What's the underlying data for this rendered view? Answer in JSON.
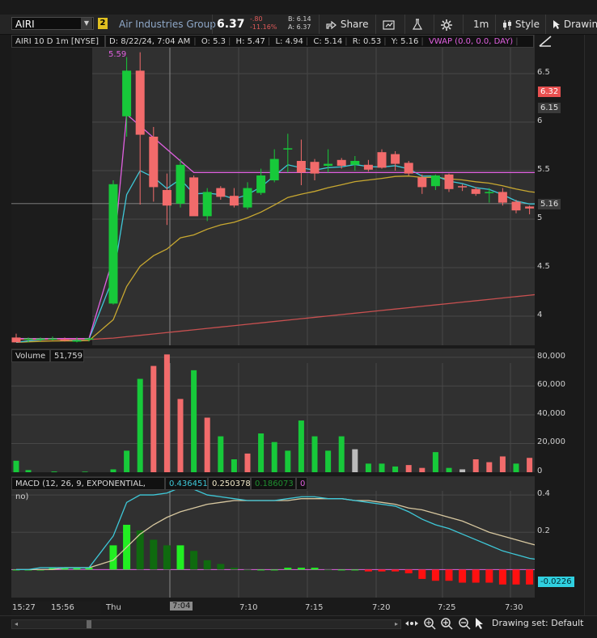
{
  "toolbar": {
    "symbol": "AIRI",
    "link_badge": "2",
    "company": "Air Industries Group",
    "last_price": "6.37",
    "change": "-.80",
    "change_pct": "-11.16%",
    "bid": "B: 6.14",
    "ask": "A: 6.37",
    "share_label": "Share",
    "timeframe_label": "1m",
    "style_label": "Style",
    "drawing_label": "Drawin"
  },
  "price_panel": {
    "symbol_label": "AIRI 10 D 1m [NYSE]",
    "ohlc": {
      "date": "D: 8/22/24, 7:04 AM",
      "open": "O: 5.3",
      "high": "H: 5.47",
      "low": "L: 4.94",
      "close": "C: 5.14",
      "range": "R: 0.53",
      "y": "Y: 5.16"
    },
    "vwap_label": "VWAP (0.0, 0.0, DAY)",
    "vwap_value": "5.59",
    "y_ticks": [
      "6.5",
      "6",
      "5.5",
      "5",
      "4.5",
      "4"
    ],
    "price_tags": [
      {
        "label": "6.32",
        "color": "#e85050"
      },
      {
        "label": "6.15",
        "color": "#3a3a3a"
      },
      {
        "label": "5.16",
        "color": "#3a3a3a"
      }
    ]
  },
  "volume_panel": {
    "label": "Volume",
    "value": "51,759",
    "y_ticks": [
      "80,000",
      "60,000",
      "40,000",
      "20,000",
      "0"
    ]
  },
  "macd_panel": {
    "label": "MACD (12, 26, 9, EXPONENTIAL, no)",
    "value": "0.436451",
    "avg": "0.250378",
    "diff": "0.186073",
    "zero": "0",
    "y_ticks": [
      "0.4",
      "0.2"
    ],
    "current_tag": "-0.0226"
  },
  "x_axis": {
    "labels": [
      "15:27",
      "15:56",
      "Thu",
      "7:04",
      "7:10",
      "7:15",
      "7:20",
      "7:25",
      "7:30"
    ],
    "highlight": "7:04"
  },
  "footer": {
    "drawing_set": "Drawing set: Default"
  },
  "colors": {
    "up": "#17c93a",
    "down": "#f26b6b",
    "vwap": "#e060e0",
    "ema_fast": "#3ec8d8",
    "ema_mid": "#c8a830",
    "ema_slow": "#c85050",
    "macd_line": "#3ec8d8",
    "signal_line": "#d8c8a0"
  },
  "chart_data": {
    "type": "candlestick",
    "candles": [
      {
        "o": 3.78,
        "h": 3.82,
        "l": 3.74,
        "c": 3.73
      },
      {
        "o": 3.76,
        "h": 3.78,
        "l": 3.73,
        "c": 3.77
      },
      {
        "o": 3.76,
        "h": 3.78,
        "l": 3.74,
        "c": 3.77
      },
      {
        "o": 3.77,
        "h": 3.79,
        "l": 3.75,
        "c": 3.77
      },
      {
        "o": 3.76,
        "h": 3.78,
        "l": 3.74,
        "c": 3.75
      },
      {
        "o": 3.75,
        "h": 3.78,
        "l": 3.73,
        "c": 3.75
      },
      {
        "o": 3.76,
        "h": 3.78,
        "l": 3.74,
        "c": 3.77
      },
      {
        "o": 4.13,
        "h": 5.4,
        "l": 4.12,
        "c": 5.36
      },
      {
        "o": 6.06,
        "h": 6.67,
        "l": 5.85,
        "c": 6.53
      },
      {
        "o": 6.53,
        "h": 6.72,
        "l": 5.15,
        "c": 5.87
      },
      {
        "o": 5.85,
        "h": 5.95,
        "l": 5.18,
        "c": 5.33
      },
      {
        "o": 5.3,
        "h": 5.47,
        "l": 4.94,
        "c": 5.14
      },
      {
        "o": 5.16,
        "h": 5.62,
        "l": 5.12,
        "c": 5.56
      },
      {
        "o": 5.43,
        "h": 5.45,
        "l": 5.04,
        "c": 5.03
      },
      {
        "o": 5.03,
        "h": 5.32,
        "l": 4.98,
        "c": 5.28
      },
      {
        "o": 5.32,
        "h": 5.34,
        "l": 5.2,
        "c": 5.23
      },
      {
        "o": 5.24,
        "h": 5.32,
        "l": 5.12,
        "c": 5.14
      },
      {
        "o": 5.12,
        "h": 5.38,
        "l": 5.1,
        "c": 5.32
      },
      {
        "o": 5.27,
        "h": 5.52,
        "l": 5.25,
        "c": 5.45
      },
      {
        "o": 5.4,
        "h": 5.72,
        "l": 5.38,
        "c": 5.62
      },
      {
        "o": 5.72,
        "h": 5.88,
        "l": 5.48,
        "c": 5.73
      },
      {
        "o": 5.6,
        "h": 5.82,
        "l": 5.35,
        "c": 5.48
      },
      {
        "o": 5.59,
        "h": 5.62,
        "l": 5.4,
        "c": 5.47
      },
      {
        "o": 5.55,
        "h": 5.72,
        "l": 5.48,
        "c": 5.57
      },
      {
        "o": 5.61,
        "h": 5.63,
        "l": 5.52,
        "c": 5.55
      },
      {
        "o": 5.56,
        "h": 5.65,
        "l": 5.5,
        "c": 5.6
      },
      {
        "o": 5.56,
        "h": 5.61,
        "l": 5.49,
        "c": 5.51
      },
      {
        "o": 5.69,
        "h": 5.72,
        "l": 5.52,
        "c": 5.53
      },
      {
        "o": 5.67,
        "h": 5.7,
        "l": 5.5,
        "c": 5.57
      },
      {
        "o": 5.58,
        "h": 5.6,
        "l": 5.45,
        "c": 5.47
      },
      {
        "o": 5.43,
        "h": 5.46,
        "l": 5.26,
        "c": 5.33
      },
      {
        "o": 5.34,
        "h": 5.46,
        "l": 5.3,
        "c": 5.45
      },
      {
        "o": 5.46,
        "h": 5.47,
        "l": 5.28,
        "c": 5.31
      },
      {
        "o": 5.34,
        "h": 5.36,
        "l": 5.29,
        "c": 5.33
      },
      {
        "o": 5.31,
        "h": 5.33,
        "l": 5.24,
        "c": 5.26
      },
      {
        "o": 5.27,
        "h": 5.32,
        "l": 5.17,
        "c": 5.28
      },
      {
        "o": 5.28,
        "h": 5.32,
        "l": 5.14,
        "c": 5.17
      },
      {
        "o": 5.18,
        "h": 5.2,
        "l": 5.06,
        "c": 5.09
      },
      {
        "o": 5.13,
        "h": 5.14,
        "l": 5.05,
        "c": 5.11
      },
      {
        "o": 5.1,
        "h": 5.2,
        "l": 5.06,
        "c": 5.16
      }
    ],
    "volume_up_down": "down=red, up=green",
    "volumes": [
      {
        "v": 8000,
        "d": "up"
      },
      {
        "v": 1500,
        "d": "up"
      },
      {
        "v": 500,
        "d": "up"
      },
      {
        "v": 400,
        "d": "up"
      },
      {
        "v": 2000,
        "d": "up"
      },
      {
        "v": 15000,
        "d": "up"
      },
      {
        "v": 65000,
        "d": "up"
      },
      {
        "v": 74000,
        "d": "down"
      },
      {
        "v": 82000,
        "d": "down"
      },
      {
        "v": 51000,
        "d": "down"
      },
      {
        "v": 71000,
        "d": "up"
      },
      {
        "v": 38000,
        "d": "down"
      },
      {
        "v": 25000,
        "d": "up"
      },
      {
        "v": 9000,
        "d": "up"
      },
      {
        "v": 13000,
        "d": "down"
      },
      {
        "v": 27000,
        "d": "up"
      },
      {
        "v": 21000,
        "d": "up"
      },
      {
        "v": 15000,
        "d": "up"
      },
      {
        "v": 36000,
        "d": "up"
      },
      {
        "v": 25000,
        "d": "up"
      },
      {
        "v": 15000,
        "d": "up"
      },
      {
        "v": 25000,
        "d": "up"
      },
      {
        "v": 16000,
        "d": "flat"
      },
      {
        "v": 6000,
        "d": "up"
      },
      {
        "v": 6000,
        "d": "up"
      },
      {
        "v": 4000,
        "d": "up"
      },
      {
        "v": 5000,
        "d": "down"
      },
      {
        "v": 3000,
        "d": "down"
      },
      {
        "v": 14000,
        "d": "up"
      },
      {
        "v": 3000,
        "d": "up"
      },
      {
        "v": 2000,
        "d": "flat"
      },
      {
        "v": 9000,
        "d": "down"
      },
      {
        "v": 7000,
        "d": "down"
      },
      {
        "v": 11000,
        "d": "down"
      },
      {
        "v": 6000,
        "d": "up"
      },
      {
        "v": 10000,
        "d": "down"
      },
      {
        "v": 8000,
        "d": "down"
      },
      {
        "v": 3000,
        "d": "up"
      }
    ],
    "macd_line": [
      0.0,
      0.0,
      0.01,
      0.01,
      0.01,
      0.01,
      0.01,
      0.18,
      0.36,
      0.4,
      0.4,
      0.41,
      0.44,
      0.43,
      0.4,
      0.39,
      0.38,
      0.37,
      0.37,
      0.37,
      0.38,
      0.39,
      0.39,
      0.38,
      0.38,
      0.37,
      0.36,
      0.35,
      0.34,
      0.31,
      0.27,
      0.24,
      0.22,
      0.19,
      0.16,
      0.13,
      0.1,
      0.08,
      0.06,
      0.05
    ],
    "signal_line": [
      0.0,
      0.0,
      0.0,
      0.0,
      0.01,
      0.01,
      0.01,
      0.05,
      0.12,
      0.19,
      0.24,
      0.28,
      0.31,
      0.33,
      0.35,
      0.36,
      0.37,
      0.37,
      0.37,
      0.37,
      0.37,
      0.38,
      0.38,
      0.38,
      0.38,
      0.37,
      0.37,
      0.36,
      0.35,
      0.33,
      0.32,
      0.3,
      0.28,
      0.26,
      0.23,
      0.2,
      0.18,
      0.16,
      0.14,
      0.12
    ],
    "macd_hist": [
      0.0,
      0.0,
      0.0,
      0.01,
      0.01,
      0.01,
      0.01,
      0.13,
      0.24,
      0.21,
      0.16,
      0.13,
      0.13,
      0.1,
      0.05,
      0.03,
      0.01,
      0.0,
      0.0,
      0.0,
      0.01,
      0.01,
      0.01,
      0.0,
      0.0,
      0.0,
      -0.01,
      -0.01,
      -0.01,
      -0.02,
      -0.05,
      -0.06,
      -0.06,
      -0.07,
      -0.07,
      -0.07,
      -0.08,
      -0.08,
      -0.08,
      -0.07
    ],
    "price_ylim": [
      3.7,
      6.9
    ],
    "volume_ylim": [
      0,
      85000
    ],
    "macd_ylim": [
      -0.15,
      0.5
    ]
  }
}
